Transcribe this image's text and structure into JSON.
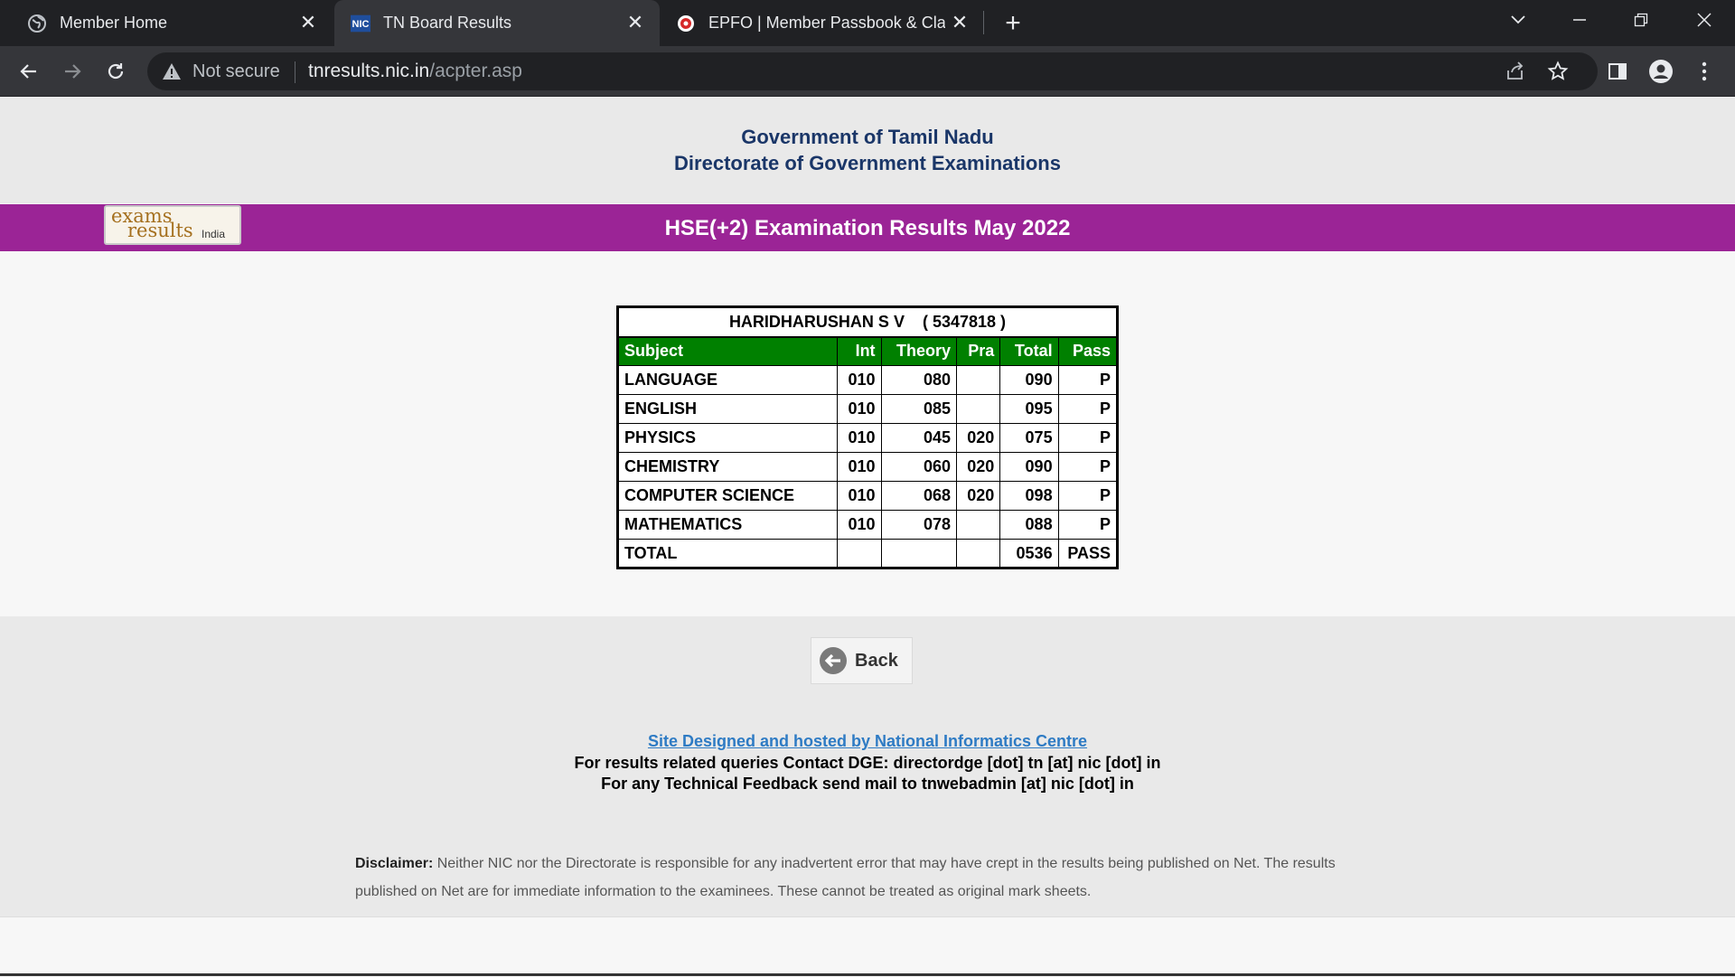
{
  "browser": {
    "tabs": [
      {
        "title": "Member Home",
        "icon": "globe-icon",
        "active": false
      },
      {
        "title": "TN Board Results",
        "icon": "nic-icon",
        "active": true
      },
      {
        "title": "EPFO | Member Passbook & Clai",
        "icon": "epfo-icon",
        "active": false
      }
    ],
    "address": {
      "security_label": "Not secure",
      "host": "tnresults.nic.in",
      "path": "/acpter.asp"
    }
  },
  "page": {
    "gov_line1": "Government of Tamil Nadu",
    "gov_line2": "Directorate of Government Examinations",
    "logo": {
      "line1": "exams",
      "line2": "results",
      "line3": "India"
    },
    "exam_title": "HSE(+2)  Examination Results  May 2022",
    "student": {
      "name": "HARIDHARUSHAN S V",
      "reg_no": "( 5347818 )"
    },
    "table": {
      "headers": [
        "Subject",
        "Int",
        "Theory",
        "Pra",
        "Total",
        "Pass"
      ],
      "rows": [
        [
          "LANGUAGE",
          "010",
          "080",
          "",
          "090",
          "P"
        ],
        [
          "ENGLISH",
          "010",
          "085",
          "",
          "095",
          "P"
        ],
        [
          "PHYSICS",
          "010",
          "045",
          "020",
          "075",
          "P"
        ],
        [
          "CHEMISTRY",
          "010",
          "060",
          "020",
          "090",
          "P"
        ],
        [
          "COMPUTER SCIENCE",
          "010",
          "068",
          "020",
          "098",
          "P"
        ],
        [
          "MATHEMATICS",
          "010",
          "078",
          "",
          "088",
          "P"
        ]
      ],
      "total_row": [
        "TOTAL",
        "",
        "",
        "",
        "0536",
        "PASS"
      ]
    },
    "back_label": "Back",
    "footer": {
      "link": "Site Designed and hosted by National Informatics Centre",
      "line1": "For results related queries Contact DGE:  directordge [dot] tn [at] nic [dot] in",
      "line2": "For any Technical Feedback send mail to tnwebadmin [at] nic [dot] in"
    },
    "disclaimer": {
      "label": "Disclaimer:",
      "text": " Neither NIC nor the Directorate is responsible for any inadvertent error that may have crept in the results being published on Net. The results published on Net are for immediate information to the examinees. These cannot be treated as original mark sheets."
    }
  },
  "colors": {
    "purple_bar": "#9b2496",
    "table_header": "#008000",
    "gov_title": "#1a3668",
    "link": "#2e7bc4"
  }
}
